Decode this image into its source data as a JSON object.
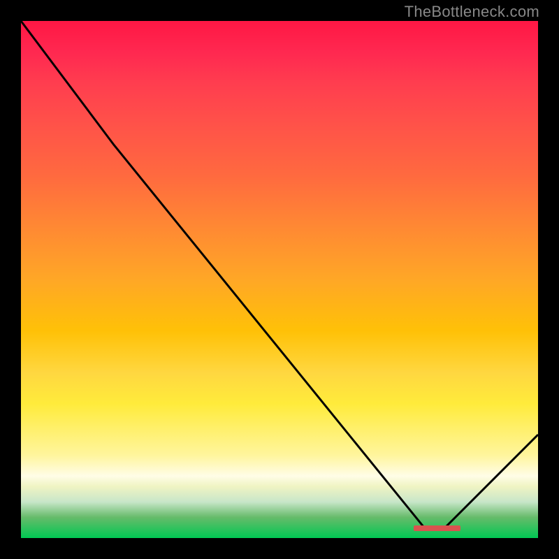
{
  "attribution": "TheBottleneck.com",
  "chart_data": {
    "type": "line",
    "title": "",
    "xlabel": "",
    "ylabel": "",
    "xlim": [
      0,
      100
    ],
    "ylim": [
      0,
      100
    ],
    "x": [
      0,
      18,
      78,
      82,
      100
    ],
    "values": [
      100,
      76,
      2,
      2,
      20
    ],
    "optimal_range": {
      "start": 76,
      "end": 85
    },
    "background_gradient": {
      "top": "#ff1744",
      "mid": "#ffc107",
      "bottom": "#00c853"
    }
  }
}
